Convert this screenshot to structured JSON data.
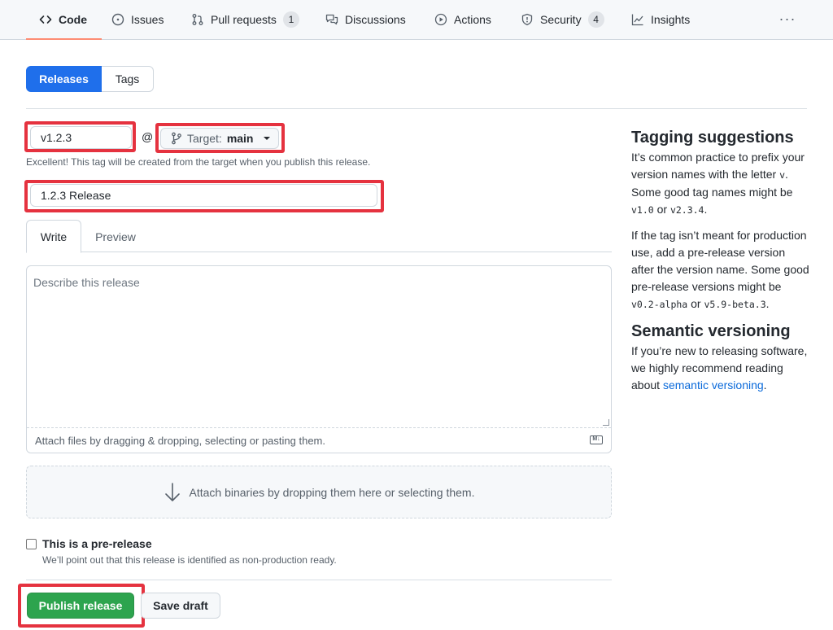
{
  "nav": {
    "tabs": [
      {
        "label": "Code",
        "icon": "code-icon"
      },
      {
        "label": "Issues",
        "icon": "issue-icon"
      },
      {
        "label": "Pull requests",
        "icon": "pull-request-icon",
        "count": "1"
      },
      {
        "label": "Discussions",
        "icon": "discussion-icon"
      },
      {
        "label": "Actions",
        "icon": "play-icon"
      },
      {
        "label": "Security",
        "icon": "shield-icon",
        "count": "4"
      },
      {
        "label": "Insights",
        "icon": "graph-icon"
      }
    ],
    "more": "···"
  },
  "segment": {
    "releases": "Releases",
    "tags": "Tags"
  },
  "form": {
    "tag_value": "v1.2.3",
    "at": "@",
    "target_label": "Target:",
    "target_value": "main",
    "tag_note": "Excellent! This tag will be created from the target when you publish this release.",
    "title_value": "1.2.3 Release",
    "write_tab": "Write",
    "preview_tab": "Preview",
    "body_placeholder": "Describe this release",
    "attach_files": "Attach files by dragging & dropping, selecting or pasting them.",
    "attach_binaries": "Attach binaries by dropping them here or selecting them.",
    "prerelease_label": "This is a pre-release",
    "prerelease_note": "We’ll point out that this release is identified as non-production ready.",
    "publish": "Publish release",
    "save_draft": "Save draft"
  },
  "sidebar": {
    "tagging_title": "Tagging suggestions",
    "tagging_p1_a": "It’s common practice to prefix your version names with the letter ",
    "tagging_p1_code1": "v",
    "tagging_p1_b": ". Some good tag names might be ",
    "tagging_p1_code2": "v1.0",
    "tagging_p1_c": " or ",
    "tagging_p1_code3": "v2.3.4",
    "tagging_p1_d": ".",
    "tagging_p2_a": "If the tag isn’t meant for production use, add a pre-release version after the version name. Some good pre-release versions might be ",
    "tagging_p2_code1": "v0.2-alpha",
    "tagging_p2_b": " or ",
    "tagging_p2_code2": "v5.9-beta.3",
    "tagging_p2_c": ".",
    "semver_title": "Semantic versioning",
    "semver_p_a": "If you’re new to releasing software, we highly recommend reading about ",
    "semver_link": "semantic versioning",
    "semver_p_b": "."
  },
  "colors": {
    "accent": "#1f6feb",
    "publish": "#2da44e",
    "highlight": "#e5323f",
    "link": "#0969da"
  }
}
